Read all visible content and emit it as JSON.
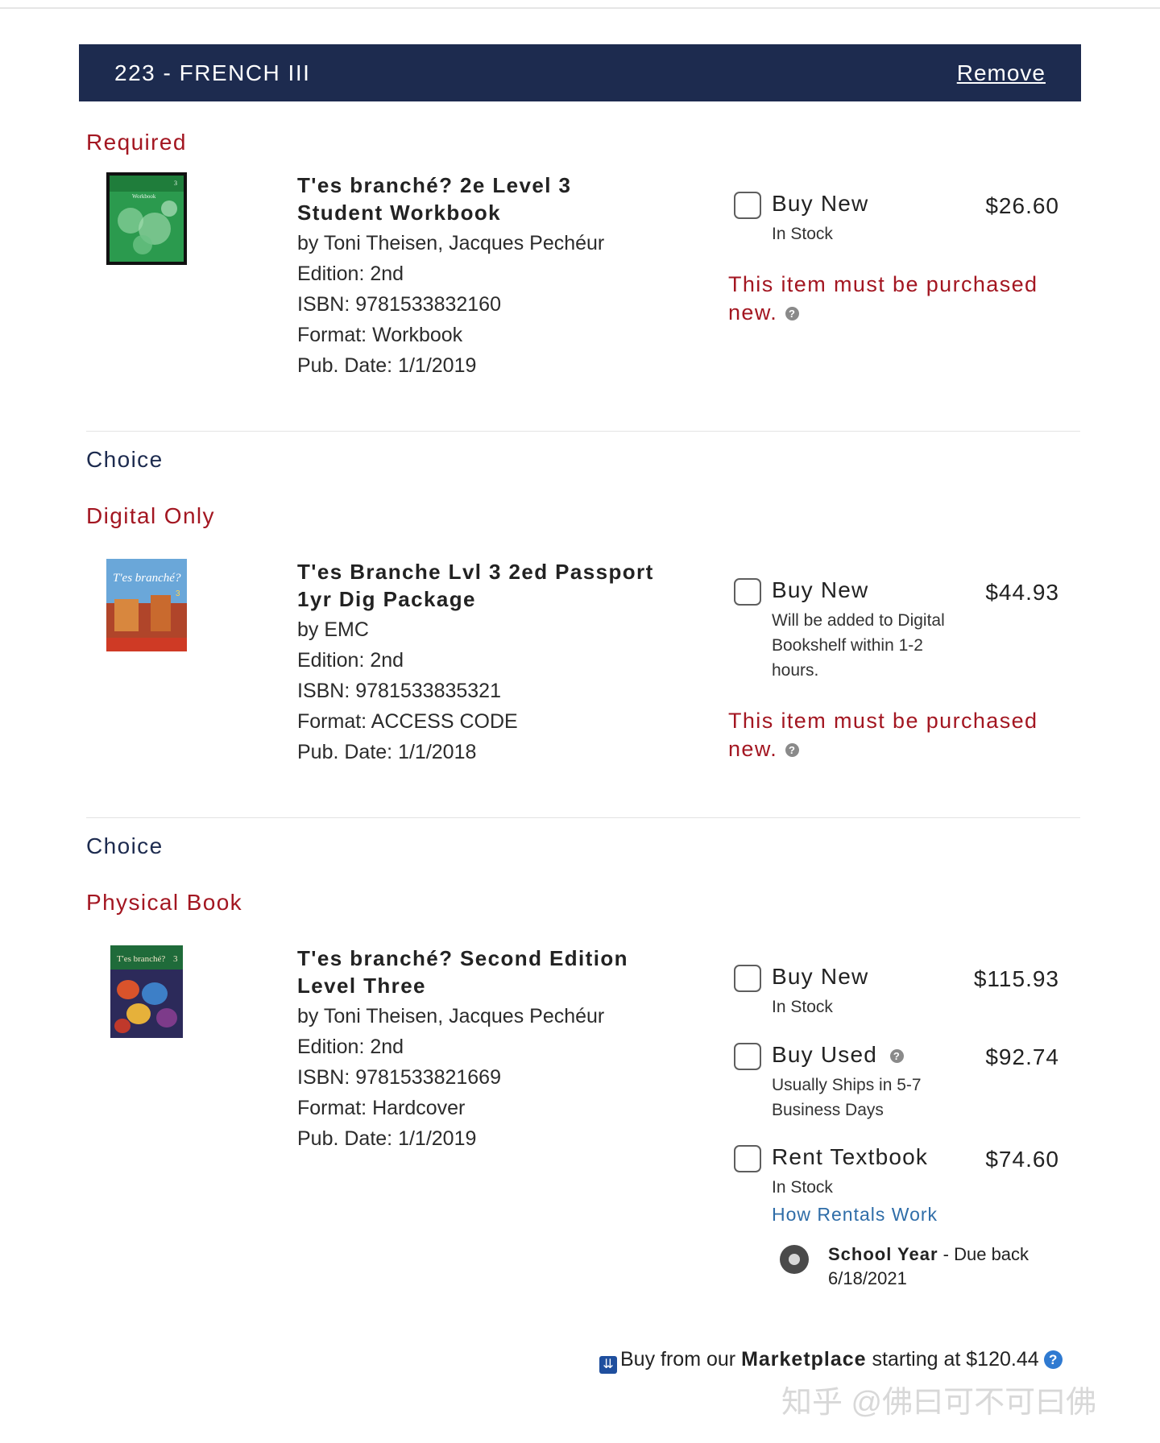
{
  "course": {
    "title": "223 - FRENCH III",
    "remove_label": "Remove"
  },
  "sections": {
    "required_label": "Required",
    "choice_label": "Choice",
    "digital_only_label": "Digital Only",
    "physical_book_label": "Physical Book"
  },
  "books": [
    {
      "title": "T'es branché? 2e Level 3 Student Workbook",
      "author": "by Toni Theisen, Jacques Pechéur",
      "edition": "Edition: 2nd",
      "isbn": "ISBN: 9781533832160",
      "format": "Format: Workbook",
      "pub_date": "Pub. Date: 1/1/2019",
      "cover_text": [
        "Workbook",
        "3"
      ],
      "options": [
        {
          "label": "Buy New",
          "price": "$26.60",
          "sub": "In Stock"
        }
      ],
      "must_new": "This item must be purchased new."
    },
    {
      "title": "T'es Branche Lvl 3 2ed Passport 1yr Dig Package",
      "author": "by EMC",
      "edition": "Edition: 2nd",
      "isbn": "ISBN: 9781533835321",
      "format": "Format: ACCESS CODE",
      "pub_date": "Pub. Date: 1/1/2018",
      "cover_text": [
        "T'es branché?",
        "3"
      ],
      "options": [
        {
          "label": "Buy New",
          "price": "$44.93",
          "sub": "Will be added to Digital Bookshelf within 1-2 hours."
        }
      ],
      "must_new": "This item must be purchased new."
    },
    {
      "title": "T'es branché? Second Edition Level Three",
      "author": "by Toni Theisen, Jacques Pechéur",
      "edition": "Edition: 2nd",
      "isbn": "ISBN: 9781533821669",
      "format": "Format: Hardcover",
      "pub_date": "Pub. Date: 1/1/2019",
      "cover_text": [
        "T'es branché?",
        "3"
      ],
      "options": [
        {
          "label": "Buy New",
          "price": "$115.93",
          "sub": "In Stock"
        },
        {
          "label": "Buy Used",
          "price": "$92.74",
          "sub": "Usually Ships in 5-7 Business Days"
        },
        {
          "label": "Rent Textbook",
          "price": "$74.60",
          "sub": "In Stock"
        }
      ],
      "rental": {
        "link": "How Rentals Work",
        "term_name": "School Year",
        "term_detail": " - Due back 6/18/2021"
      }
    }
  ],
  "help_glyph": "?",
  "marketplace": {
    "prefix": "Buy from our ",
    "name": "Marketplace",
    "suffix": " starting at $120.44",
    "icon": "marketplace-icon"
  },
  "watermark": "知乎 @佛曰可不可曰佛",
  "colors": {
    "header_bg": "#1d2b4f",
    "accent_red": "#a31621",
    "link_blue": "#2f6da8"
  }
}
